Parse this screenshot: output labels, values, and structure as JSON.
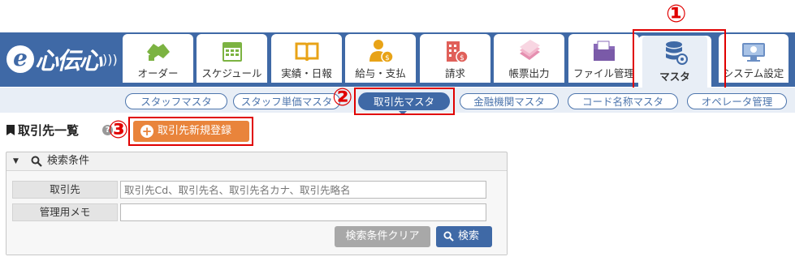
{
  "logo": {
    "mark": "e",
    "text": "心伝心"
  },
  "tabs": [
    {
      "label": "オーダー",
      "icon": "handshake-icon"
    },
    {
      "label": "スケジュール",
      "icon": "calendar-icon"
    },
    {
      "label": "実績・日報",
      "icon": "book-icon"
    },
    {
      "label": "給与・支払",
      "icon": "person-coin-icon"
    },
    {
      "label": "請求",
      "icon": "building-coin-icon"
    },
    {
      "label": "帳票出力",
      "icon": "papers-icon"
    },
    {
      "label": "ファイル管理",
      "icon": "folder-icon"
    },
    {
      "label": "マスタ",
      "icon": "database-gear-icon",
      "active": true
    },
    {
      "label": "システム設定",
      "icon": "monitor-gear-icon"
    }
  ],
  "annotations": {
    "one": "①",
    "two": "②",
    "three": "③"
  },
  "subnav": [
    {
      "label": "スタッフマスタ"
    },
    {
      "label": "スタッフ単価マスタ"
    },
    {
      "label": "取引先マスタ",
      "active": true
    },
    {
      "label": "金融機関マスタ"
    },
    {
      "label": "コード名称マスタ"
    },
    {
      "label": "オペレータ管理"
    }
  ],
  "page": {
    "title": "取引先一覧",
    "help": "?",
    "new_button": "取引先新規登録",
    "new_button_plus": "+"
  },
  "search": {
    "header": "検索条件",
    "toggle": "▼",
    "rows": [
      {
        "label": "取引先",
        "placeholder": "取引先Cd、取引先名、取引先名カナ、取引先略名",
        "value": ""
      },
      {
        "label": "管理用メモ",
        "placeholder": "",
        "value": ""
      }
    ],
    "clear_button": "検索条件クリア",
    "search_button": "検索"
  },
  "colors": {
    "primary": "#3f69a6",
    "accent": "#e9843b",
    "annotation": "#e00000"
  }
}
